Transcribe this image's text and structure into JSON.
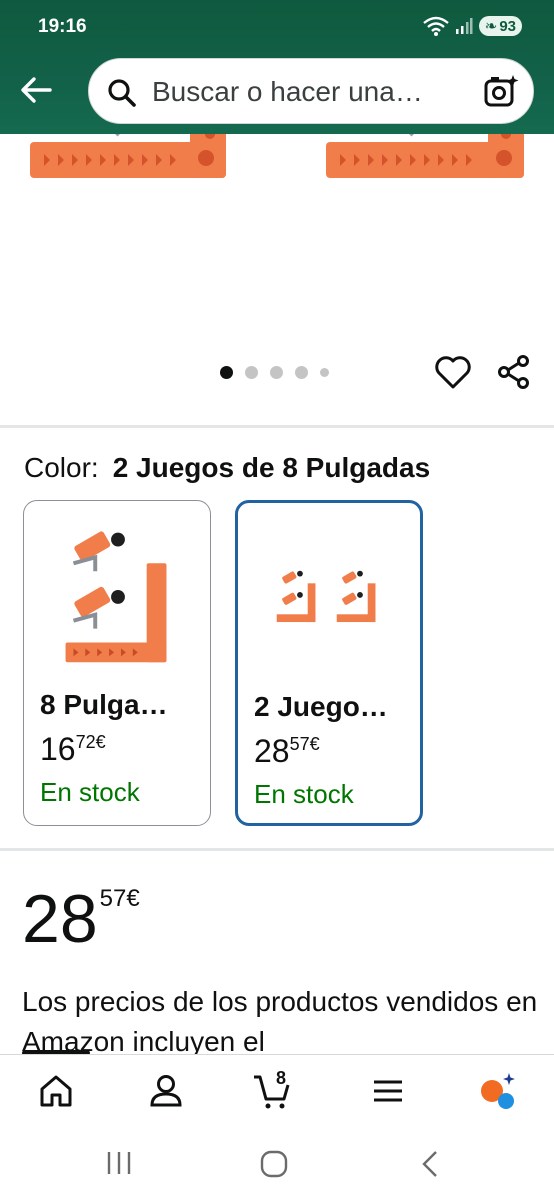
{
  "status_bar": {
    "time": "19:16",
    "battery": "93"
  },
  "search": {
    "placeholder": "Buscar o hacer una…"
  },
  "carousel": {
    "total": 5,
    "active_index": 0
  },
  "color": {
    "label": "Color:",
    "value": "2 Juegos de 8 Pulgadas"
  },
  "variants": [
    {
      "name": "8 Pulga…",
      "price_whole": "16",
      "price_fraction": "72",
      "currency": "€",
      "stock": "En stock",
      "selected": false
    },
    {
      "name": "2 Juego…",
      "price_whole": "28",
      "price_fraction": "57",
      "currency": "€",
      "stock": "En stock",
      "selected": true
    }
  ],
  "price": {
    "whole": "28",
    "fraction": "57",
    "currency": "€"
  },
  "price_note": "Los precios de los productos vendidos en Amazon incluyen el",
  "bottom_nav": {
    "cart_count": "8"
  },
  "colors": {
    "header": "#0f5a3f",
    "accent_blue": "#2162a1",
    "stock_green": "#007600",
    "product_orange": "#f07d4a"
  }
}
